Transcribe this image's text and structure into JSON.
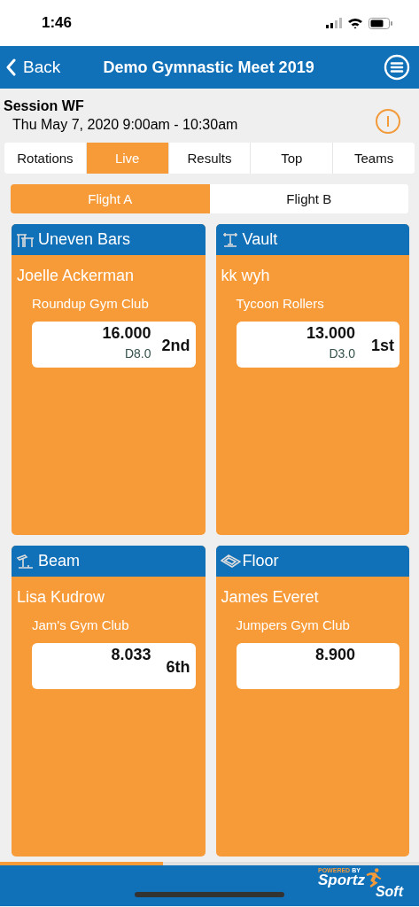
{
  "status_bar": {
    "time": "1:46"
  },
  "header": {
    "back": "Back",
    "title": "Demo Gymnastic Meet 2019"
  },
  "session": {
    "name": "Session WF",
    "time": "Thu May 7, 2020 9:00am - 10:30am"
  },
  "tabs": [
    {
      "label": "Rotations",
      "selected": false
    },
    {
      "label": "Live",
      "selected": true
    },
    {
      "label": "Results",
      "selected": false
    },
    {
      "label": "Top",
      "selected": false
    },
    {
      "label": "Teams",
      "selected": false
    }
  ],
  "flights": [
    {
      "label": "Flight A",
      "selected": true
    },
    {
      "label": "Flight B",
      "selected": false
    }
  ],
  "events": [
    {
      "kind": "bars",
      "name": "Uneven Bars",
      "athlete": "Joelle Ackerman",
      "club": "Roundup Gym Club",
      "score": "16.000",
      "difficulty": "D8.0",
      "rank": "2nd"
    },
    {
      "kind": "vault",
      "name": "Vault",
      "athlete": "kk wyh",
      "club": "Tycoon Rollers",
      "score": "13.000",
      "difficulty": "D3.0",
      "rank": "1st"
    },
    {
      "kind": "beam",
      "name": "Beam",
      "athlete": "Lisa Kudrow",
      "club": "Jam's Gym Club",
      "score": "8.033",
      "rank": "6th"
    },
    {
      "kind": "floor",
      "name": "Floor",
      "athlete": "James Everet",
      "club": "Jumpers Gym Club",
      "score": "8.900"
    }
  ],
  "progress": {
    "level": 0.39
  },
  "footer": {
    "tagline_1": "POWERED",
    "tagline_2": "BY",
    "brand_1": "Sportz",
    "brand_2": "Soft"
  }
}
